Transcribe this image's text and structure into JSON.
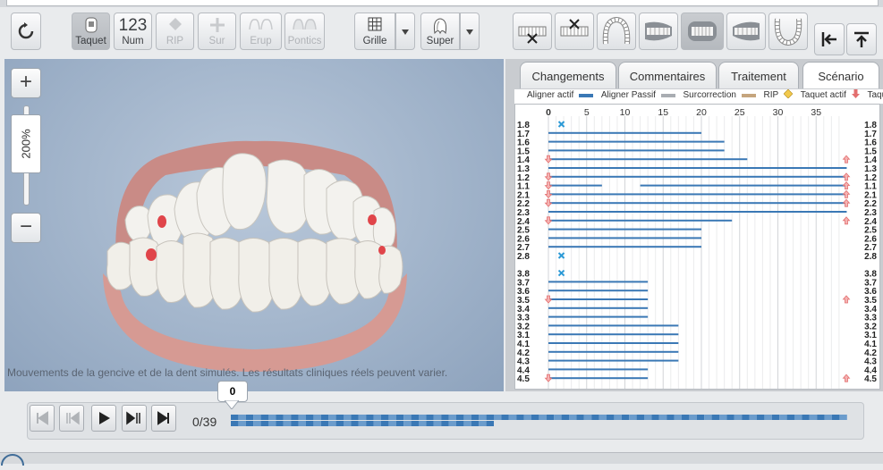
{
  "toolbar": {
    "reset_icon": "rotate-icon",
    "taquet_label": "Taquet",
    "num_big": "123",
    "num_label": "Num",
    "rip_label": "RIP",
    "sur_label": "Sur",
    "erup_label": "Erup",
    "pontics_label": "Pontics",
    "grille_label": "Grille",
    "super_label": "Super",
    "view_icons": [
      "view-lower-occlusal-x-icon",
      "view-upper-occlusal-x-icon",
      "view-upper-arch-icon",
      "view-right-buccal-icon",
      "view-front-icon",
      "view-left-buccal-icon",
      "view-lower-arch-icon"
    ],
    "panel_icons": [
      "dock-left-icon",
      "dock-top-icon"
    ]
  },
  "viewport": {
    "zoom_value": "200%",
    "disclaimer": "Mouvements de la gencive et de la dent simulés. Les résultats cliniques réels peuvent varier."
  },
  "panel": {
    "tabs": [
      "Changements",
      "Commentaires",
      "Traitement",
      "Scénario"
    ],
    "active_tab": "Scénario",
    "legend": {
      "aligner_actif": "Aligner actif",
      "aligner_passif": "Aligner Passif",
      "surcorrection": "Surcorrection",
      "rip": "RIP",
      "taquet_actif": "Taquet actif",
      "taquet_inactif": "Taquet ina"
    },
    "colors": {
      "aligner_actif": "#3a78b5",
      "aligner_passif": "#a9adb2",
      "surcorrection": "#c5a57e",
      "rip": "#f2c94c",
      "taquet": "#e36f6f",
      "missing": "#2c9ad6"
    }
  },
  "chart_data": {
    "type": "gantt",
    "x_ticks": [
      0,
      5,
      10,
      15,
      20,
      25,
      30,
      35
    ],
    "xlim": [
      0,
      38
    ],
    "teeth": [
      {
        "id": "1.8",
        "bars": [],
        "missing": true
      },
      {
        "id": "1.7",
        "bars": [
          [
            0,
            20
          ]
        ]
      },
      {
        "id": "1.6",
        "bars": [
          [
            0,
            23
          ]
        ]
      },
      {
        "id": "1.5",
        "bars": [
          [
            0,
            23
          ]
        ]
      },
      {
        "id": "1.4",
        "bars": [
          [
            0,
            26
          ]
        ],
        "attach_start": "down",
        "attach_end": "up"
      },
      {
        "id": "1.3",
        "bars": [
          [
            0,
            39
          ]
        ]
      },
      {
        "id": "1.2",
        "bars": [
          [
            0,
            39
          ]
        ],
        "attach_start": "down",
        "attach_end": "up"
      },
      {
        "id": "1.1",
        "bars": [
          [
            0,
            7
          ],
          [
            12,
            39
          ]
        ],
        "attach_start": "down",
        "attach_end": "up"
      },
      {
        "id": "2.1",
        "bars": [
          [
            0,
            39
          ]
        ],
        "attach_start": "down",
        "attach_end": "up"
      },
      {
        "id": "2.2",
        "bars": [
          [
            0,
            39
          ]
        ],
        "attach_start": "down",
        "attach_end": "up"
      },
      {
        "id": "2.3",
        "bars": [
          [
            0,
            39
          ]
        ]
      },
      {
        "id": "2.4",
        "bars": [
          [
            0,
            24
          ]
        ],
        "attach_start": "down",
        "attach_end": "up"
      },
      {
        "id": "2.5",
        "bars": [
          [
            0,
            20
          ]
        ]
      },
      {
        "id": "2.6",
        "bars": [
          [
            0,
            20
          ]
        ]
      },
      {
        "id": "2.7",
        "bars": [
          [
            0,
            20
          ]
        ]
      },
      {
        "id": "2.8",
        "bars": [],
        "missing": true
      },
      {
        "id": "",
        "bars": []
      },
      {
        "id": "3.8",
        "bars": [],
        "missing": true
      },
      {
        "id": "3.7",
        "bars": [
          [
            0,
            13
          ]
        ]
      },
      {
        "id": "3.6",
        "bars": [
          [
            0,
            13
          ]
        ]
      },
      {
        "id": "3.5",
        "bars": [
          [
            0,
            13
          ]
        ],
        "attach_start": "down",
        "attach_end": "up"
      },
      {
        "id": "3.4",
        "bars": [
          [
            0,
            13
          ]
        ]
      },
      {
        "id": "3.3",
        "bars": [
          [
            0,
            13
          ]
        ]
      },
      {
        "id": "3.2",
        "bars": [
          [
            0,
            17
          ]
        ]
      },
      {
        "id": "3.1",
        "bars": [
          [
            0,
            17
          ]
        ]
      },
      {
        "id": "4.1",
        "bars": [
          [
            0,
            17
          ]
        ]
      },
      {
        "id": "4.2",
        "bars": [
          [
            0,
            17
          ]
        ]
      },
      {
        "id": "4.3",
        "bars": [
          [
            0,
            17
          ]
        ]
      },
      {
        "id": "4.4",
        "bars": [
          [
            0,
            13
          ]
        ]
      },
      {
        "id": "4.5",
        "bars": [
          [
            0,
            13
          ]
        ],
        "attach_start": "down",
        "attach_end": "up"
      }
    ]
  },
  "timeline": {
    "current_stage": "0",
    "counter": "0/39",
    "upper_stages": 82,
    "lower_stages": 35
  }
}
